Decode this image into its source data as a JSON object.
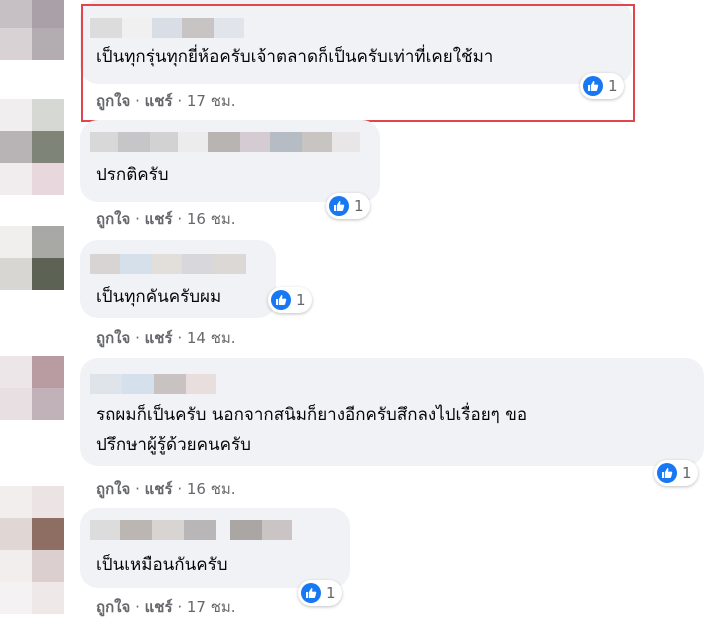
{
  "colors": {
    "highlight": "#e0464b",
    "like": "#1877f2",
    "bubble": "#f0f2f5",
    "meta": "#65676b"
  },
  "comments": [
    {
      "text_lines": [
        "เป็นทุกรุ่นทุกยี่ห้อครับเจ้าตลาดก็เป็นครับเท่าที่เคยใช้มา"
      ],
      "like_label": "ถูกใจ",
      "share_label": "แชร์",
      "separator": "·",
      "time": "17 ชม.",
      "reactions": "1",
      "reaction_icon": "thumbs-up-icon",
      "highlighted": true
    },
    {
      "text_lines": [
        "ปรกติครับ"
      ],
      "like_label": "ถูกใจ",
      "share_label": "แชร์",
      "separator": "·",
      "time": "16 ชม.",
      "reactions": "1",
      "reaction_icon": "thumbs-up-icon",
      "highlighted": false
    },
    {
      "text_lines": [
        "เป็นทุกคันครับผม"
      ],
      "like_label": "ถูกใจ",
      "share_label": "แชร์",
      "separator": "·",
      "time": "14 ชม.",
      "reactions": "1",
      "reaction_icon": "thumbs-up-icon",
      "highlighted": false
    },
    {
      "text_lines": [
        "รถผมก็เป็นครับ นอกจากสนิมก็ยางอีกครับสึกลงไปเรื่อยๆ ขอ",
        "ปรึกษาผู้รู้ด้วยคนครับ"
      ],
      "like_label": "ถูกใจ",
      "share_label": "แชร์",
      "separator": "·",
      "time": "16 ชม.",
      "reactions": "1",
      "reaction_icon": "thumbs-up-icon",
      "highlighted": false
    },
    {
      "text_lines": [
        "เป็นเหมือนกันครับ"
      ],
      "like_label": "ถูกใจ",
      "share_label": "แชร์",
      "separator": "·",
      "time": "17 ชม.",
      "reactions": "1",
      "reaction_icon": "thumbs-up-icon",
      "highlighted": false
    }
  ]
}
